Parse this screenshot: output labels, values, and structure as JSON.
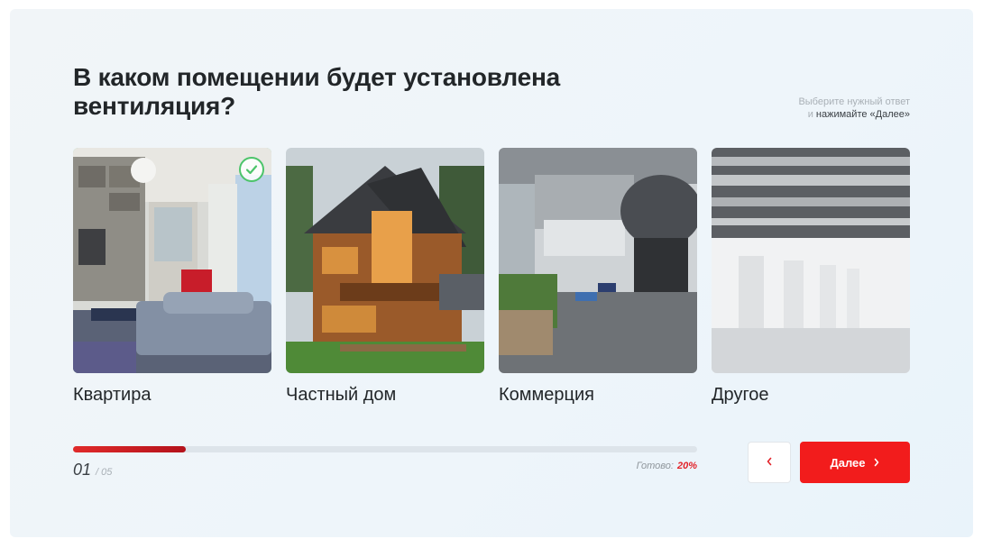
{
  "question": {
    "title": "В каком помещении будет установлена вентиляция?",
    "hint_line1": "Выберите нужный ответ",
    "hint_prefix": "и",
    "hint_line2": "нажимайте «Далее»"
  },
  "options": [
    {
      "label": "Квартира",
      "image": "apartment-living-room",
      "selected": true
    },
    {
      "label": "Частный дом",
      "image": "wooden-private-house",
      "selected": false
    },
    {
      "label": "Коммерция",
      "image": "commercial-atrium",
      "selected": false
    },
    {
      "label": "Другое",
      "image": "industrial-ceiling-ducts",
      "selected": false
    }
  ],
  "progress": {
    "current": "01",
    "total": "/ 05",
    "ready_label": "Готово:",
    "ready_value": "20%",
    "fraction": 0.18
  },
  "nav": {
    "prev_icon": "chevron-left-icon",
    "next_label": "Далее",
    "next_icon": "chevron-right-icon"
  },
  "colors": {
    "accent": "#f21c1c",
    "selected_border": "#4cc46a",
    "progress_fill": "#c8161f"
  }
}
